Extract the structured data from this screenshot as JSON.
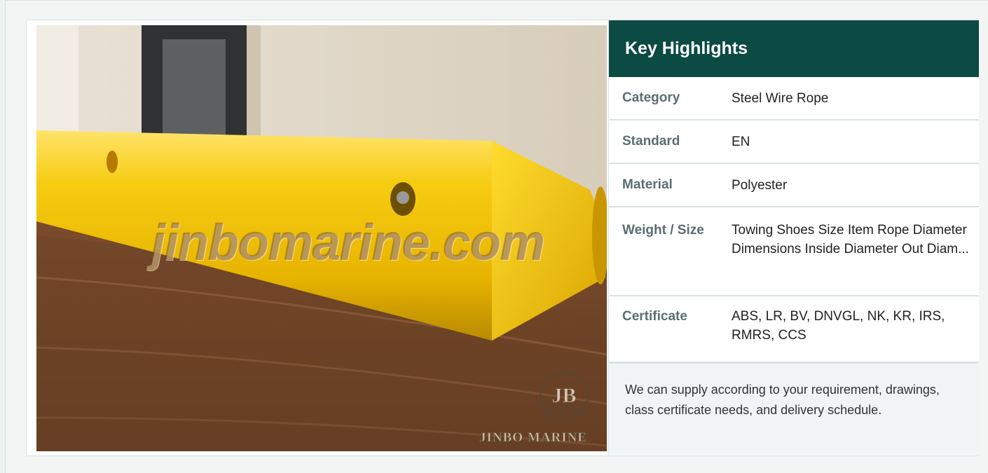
{
  "product_image": {
    "watermark": "jinbomarine.com",
    "brand_mark": "JB",
    "brand_name": "JINBO MARINE"
  },
  "highlights": {
    "title": "Key Highlights",
    "rows": [
      {
        "label": "Category",
        "value": "Steel Wire Rope"
      },
      {
        "label": "Standard",
        "value": "EN"
      },
      {
        "label": "Material",
        "value": "Polyester"
      },
      {
        "label": "Weight / Size",
        "value": "Towing Shoes Size Item Rope Diameter Dimensions Inside Diameter Out Diam..."
      },
      {
        "label": "Certificate",
        "value": "ABS, LR, BV, DNVGL, NK, KR, IRS, RMRS, CCS"
      }
    ],
    "note": "We can supply according to your requirement, drawings, class certificate needs, and delivery schedule."
  },
  "colors": {
    "header_bg": "#0c4a44",
    "label": "#5a6e71",
    "product_yellow": "#f2c400"
  }
}
